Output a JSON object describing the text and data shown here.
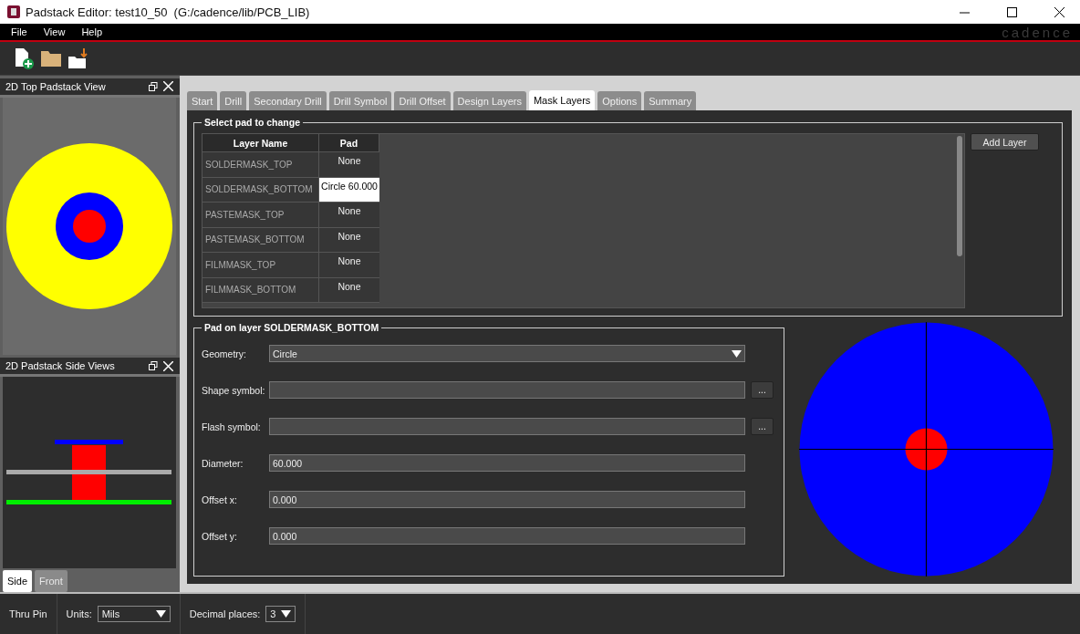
{
  "window": {
    "title": "Padstack Editor: test10_50  (G:/cadence/lib/PCB_LIB)"
  },
  "menu": [
    "File",
    "View",
    "Help"
  ],
  "logo": "cadence",
  "top_view": {
    "title": "2D Top Padstack View"
  },
  "side_view": {
    "title": "2D Padstack Side Views",
    "tabs": [
      {
        "label": "Side",
        "selected": true
      },
      {
        "label": "Front",
        "selected": false
      }
    ]
  },
  "tabs": [
    {
      "label": "Start",
      "selected": false
    },
    {
      "label": "Drill",
      "selected": false
    },
    {
      "label": "Secondary Drill",
      "selected": false
    },
    {
      "label": "Drill Symbol",
      "selected": false
    },
    {
      "label": "Drill Offset",
      "selected": false
    },
    {
      "label": "Design Layers",
      "selected": false
    },
    {
      "label": "Mask Layers",
      "selected": true
    },
    {
      "label": "Options",
      "selected": false
    },
    {
      "label": "Summary",
      "selected": false
    }
  ],
  "select_group": {
    "title": "Select pad to change",
    "columns": [
      "Layer Name",
      "Pad"
    ],
    "add_button": "Add Layer",
    "rows": [
      {
        "layer": "SOLDERMASK_TOP",
        "pad": "None",
        "selected": false
      },
      {
        "layer": "SOLDERMASK_BOTTOM",
        "pad": "Circle 60.000",
        "selected": true
      },
      {
        "layer": "PASTEMASK_TOP",
        "pad": "None",
        "selected": false
      },
      {
        "layer": "PASTEMASK_BOTTOM",
        "pad": "None",
        "selected": false
      },
      {
        "layer": "FILMMASK_TOP",
        "pad": "None",
        "selected": false
      },
      {
        "layer": "FILMMASK_BOTTOM",
        "pad": "None",
        "selected": false
      }
    ]
  },
  "pad_group": {
    "title": "Pad on layer SOLDERMASK_BOTTOM",
    "fields": [
      {
        "kind": "dropdown",
        "label": "Geometry:",
        "value": "Circle"
      },
      {
        "kind": "browse",
        "label": "Shape symbol:",
        "browse": "..."
      },
      {
        "kind": "browse",
        "label": "Flash symbol:",
        "browse": "..."
      },
      {
        "kind": "text",
        "label": "Diameter:",
        "value": "60.000"
      },
      {
        "kind": "text",
        "label": "Offset x:",
        "value": "0.000"
      },
      {
        "kind": "text",
        "label": "Offset y:",
        "value": "0.000"
      }
    ]
  },
  "status_bar": {
    "type": "Thru Pin",
    "units_label": "Units:",
    "units": "Mils",
    "decimal_label": "Decimal places:",
    "decimal": "3"
  }
}
